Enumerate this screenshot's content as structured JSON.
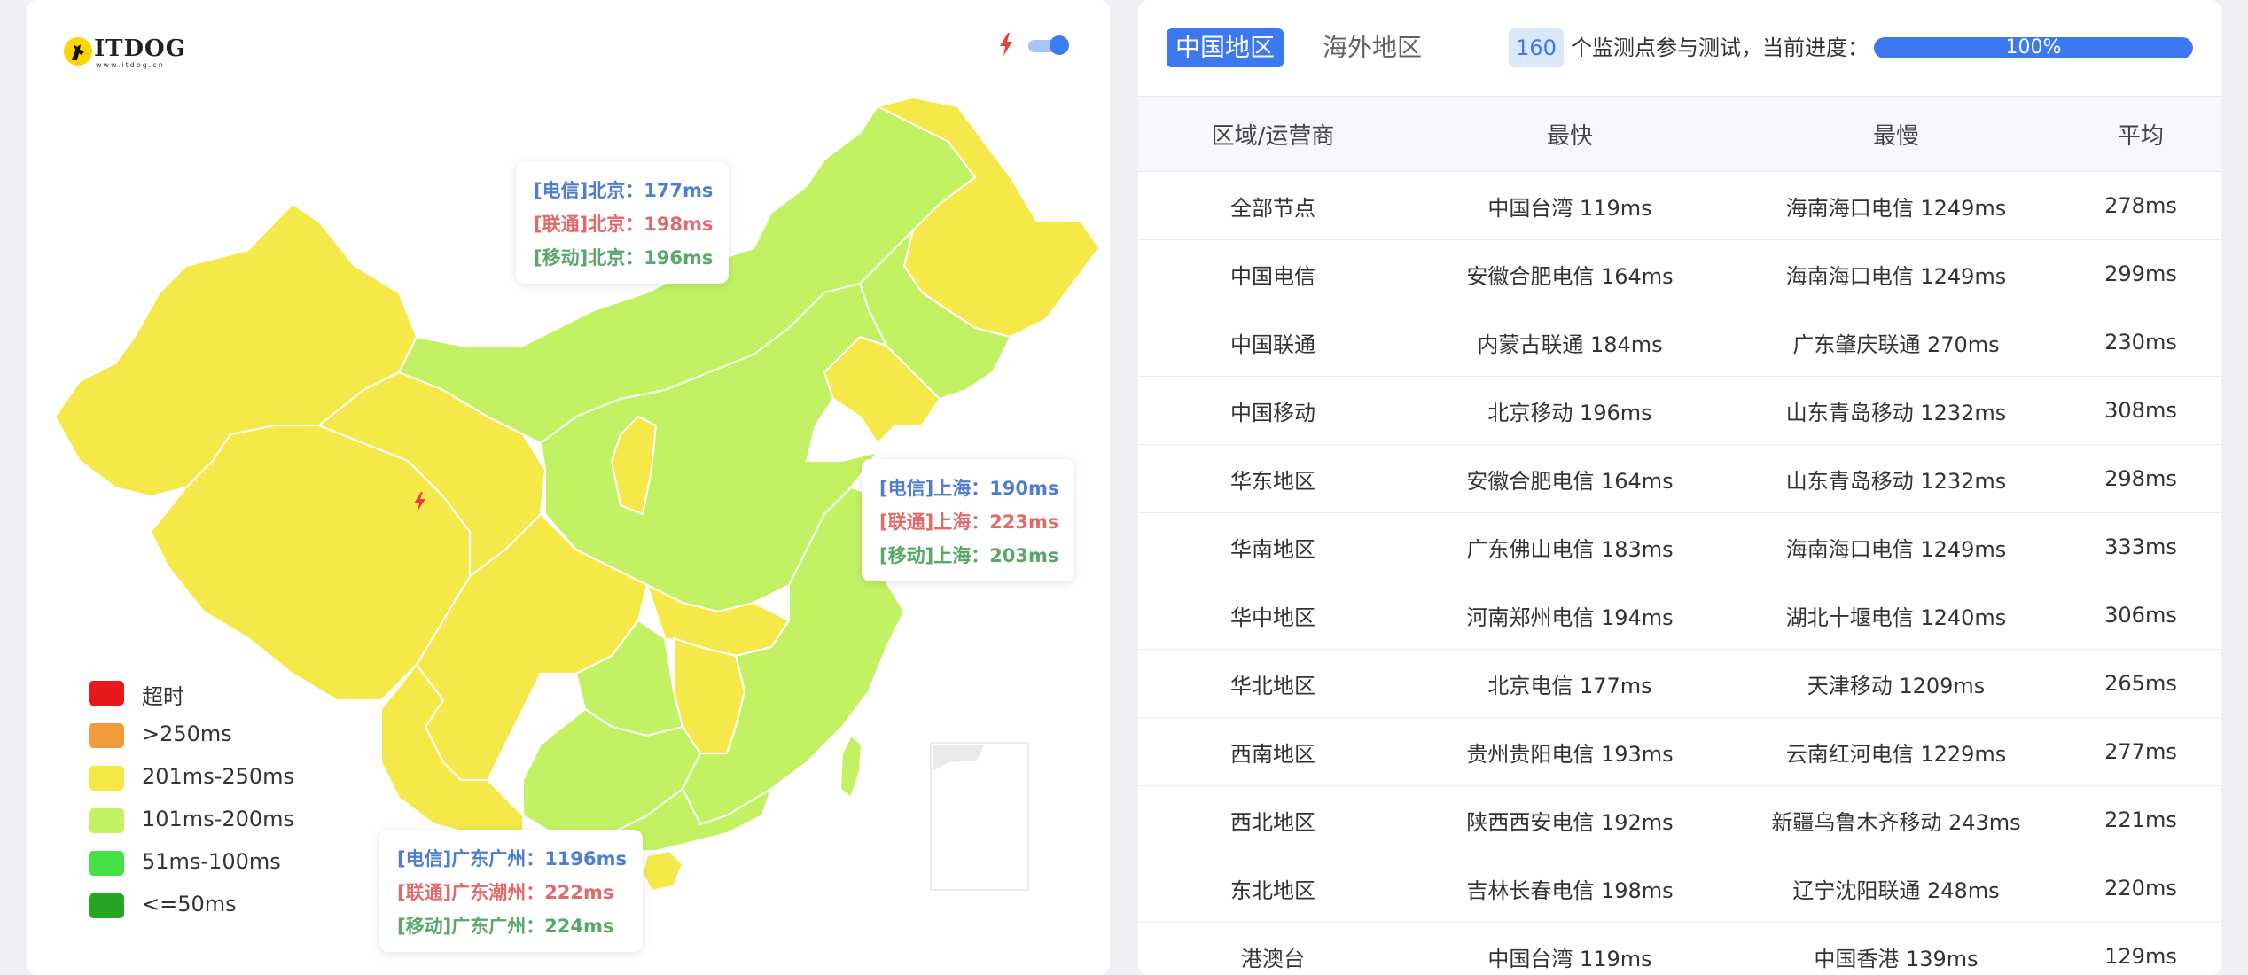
{
  "map": {
    "logo_text": "ITDOG",
    "logo_sub": "www.itdog.cn",
    "tooltips": {
      "beijing": [
        "[电信]北京：177ms",
        "[联通]北京：198ms",
        "[移动]北京：196ms"
      ],
      "shanghai": [
        "[电信]上海：190ms",
        "[联通]上海：223ms",
        "[移动]上海：203ms"
      ],
      "guangzhou": [
        "[电信]广东广州：1196ms",
        "[联通]广东潮州：222ms",
        "[移动]广东广州：224ms"
      ]
    },
    "legend": [
      {
        "label": "超时",
        "color": "#e6191d"
      },
      {
        "label": ">250ms",
        "color": "#f39a3a"
      },
      {
        "label": "201ms-250ms",
        "color": "#f5e94a"
      },
      {
        "label": "101ms-200ms",
        "color": "#c2f264"
      },
      {
        "label": "51ms-100ms",
        "color": "#44e045"
      },
      {
        "label": "<=50ms",
        "color": "#25a725"
      }
    ],
    "colors": {
      "yellow": "#f5e94a",
      "lightgreen": "#c2f264",
      "border": "#ffffff"
    },
    "toggle_on": true
  },
  "tabs": {
    "active": "中国地区",
    "inactive": "海外地区"
  },
  "status": {
    "count": "160",
    "text": "个监测点参与测试，当前进度：",
    "progress_label": "100%",
    "progress_value": 1.0
  },
  "table": {
    "headers": [
      "区域/运营商",
      "最快",
      "最慢",
      "平均"
    ],
    "rows": [
      [
        "全部节点",
        "中国台湾 119ms",
        "海南海口电信 1249ms",
        "278ms"
      ],
      [
        "中国电信",
        "安徽合肥电信 164ms",
        "海南海口电信 1249ms",
        "299ms"
      ],
      [
        "中国联通",
        "内蒙古联通 184ms",
        "广东肇庆联通 270ms",
        "230ms"
      ],
      [
        "中国移动",
        "北京移动 196ms",
        "山东青岛移动 1232ms",
        "308ms"
      ],
      [
        "华东地区",
        "安徽合肥电信 164ms",
        "山东青岛移动 1232ms",
        "298ms"
      ],
      [
        "华南地区",
        "广东佛山电信 183ms",
        "海南海口电信 1249ms",
        "333ms"
      ],
      [
        "华中地区",
        "河南郑州电信 194ms",
        "湖北十堰电信 1240ms",
        "306ms"
      ],
      [
        "华北地区",
        "北京电信 177ms",
        "天津移动 1209ms",
        "265ms"
      ],
      [
        "西南地区",
        "贵州贵阳电信 193ms",
        "云南红河电信 1229ms",
        "277ms"
      ],
      [
        "西北地区",
        "陕西西安电信 192ms",
        "新疆乌鲁木齐移动 243ms",
        "221ms"
      ],
      [
        "东北地区",
        "吉林长春电信 198ms",
        "辽宁沈阳联通 248ms",
        "220ms"
      ],
      [
        "港澳台",
        "中国台湾 119ms",
        "中国香港 139ms",
        "129ms"
      ]
    ]
  },
  "accent": "#3c78f0"
}
